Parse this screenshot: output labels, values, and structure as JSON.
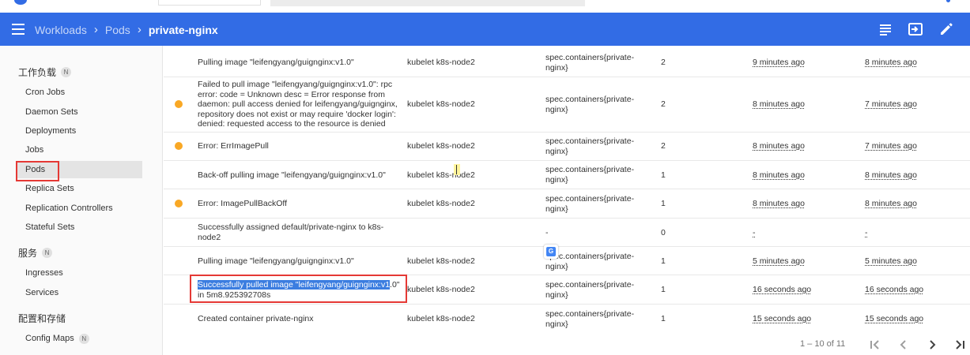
{
  "toolbar": {
    "breadcrumb": [
      "Workloads",
      "Pods"
    ],
    "current": "private-nginx",
    "accent": "#326ce5"
  },
  "sidebar": {
    "sections": [
      {
        "label": "工作负载",
        "badge": "N"
      },
      {
        "label": "服务",
        "badge": "N"
      },
      {
        "label": "配置和存储"
      }
    ],
    "items": [
      {
        "label": "Cron Jobs"
      },
      {
        "label": "Daemon Sets"
      },
      {
        "label": "Deployments"
      },
      {
        "label": "Jobs"
      },
      {
        "label": "Pods",
        "active": true
      },
      {
        "label": "Replica Sets"
      },
      {
        "label": "Replication Controllers"
      },
      {
        "label": "Stateful Sets"
      },
      {
        "label": "Ingresses"
      },
      {
        "label": "Services"
      },
      {
        "label": "Config Maps",
        "badge": "N"
      }
    ]
  },
  "events": [
    {
      "warning": false,
      "message": "Pulling image \"leifengyang/guignginx:v1.0\"",
      "source": "kubelet k8s-node2",
      "object": "spec.containers{private-nginx}",
      "count": "2",
      "first_seen": "9 minutes ago",
      "last_seen": "8 minutes ago"
    },
    {
      "warning": true,
      "message": "Failed to pull image \"leifengyang/guignginx:v1.0\": rpc error: code = Unknown desc = Error response from daemon: pull access denied for leifengyang/guignginx, repository does not exist or may require 'docker login': denied: requested access to the resource is denied",
      "source": "kubelet k8s-node2",
      "object": "spec.containers{private-nginx}",
      "count": "2",
      "first_seen": "8 minutes ago",
      "last_seen": "7 minutes ago"
    },
    {
      "warning": true,
      "message": "Error: ErrImagePull",
      "source": "kubelet k8s-node2",
      "object": "spec.containers{private-nginx}",
      "count": "2",
      "first_seen": "8 minutes ago",
      "last_seen": "7 minutes ago"
    },
    {
      "warning": false,
      "message": "Back-off pulling image \"leifengyang/guignginx:v1.0\"",
      "source": "kubelet k8s-node2",
      "object": "spec.containers{private-nginx}",
      "count": "1",
      "first_seen": "8 minutes ago",
      "last_seen": "8 minutes ago"
    },
    {
      "warning": true,
      "message": "Error: ImagePullBackOff",
      "source": "kubelet k8s-node2",
      "object": "spec.containers{private-nginx}",
      "count": "1",
      "first_seen": "8 minutes ago",
      "last_seen": "8 minutes ago"
    },
    {
      "warning": false,
      "message": "Successfully assigned default/private-nginx to k8s-node2",
      "source": "",
      "object": "-",
      "count": "0",
      "first_seen": "-",
      "last_seen": "-"
    },
    {
      "warning": false,
      "message": "Pulling image \"leifengyang/guignginx:v1.0\"",
      "source": "kubelet k8s-node2",
      "object": "spec.containers{private-nginx}",
      "count": "1",
      "first_seen": "5 minutes ago",
      "last_seen": "5 minutes ago"
    },
    {
      "warning": false,
      "message_selected": "Successfully pulled image \"leifengyang/guignginx:v1",
      "message_rest": ".0\" in 5m8.925392708s",
      "source": "kubelet k8s-node2",
      "object": "spec.containers{private-nginx}",
      "count": "1",
      "first_seen": "16 seconds ago",
      "last_seen": "16 seconds ago"
    },
    {
      "warning": false,
      "message": "Created container private-nginx",
      "source": "kubelet k8s-node2",
      "object": "spec.containers{private-nginx}",
      "count": "1",
      "first_seen": "15 seconds ago",
      "last_seen": "15 seconds ago"
    }
  ],
  "pagination": {
    "range": "1 – 10 of 11"
  },
  "icons": [
    "menu-icon",
    "list-icon",
    "exec-icon",
    "edit-icon",
    "translate-icon",
    "first-page-icon",
    "prev-page-icon",
    "next-page-icon",
    "last-page-icon"
  ]
}
